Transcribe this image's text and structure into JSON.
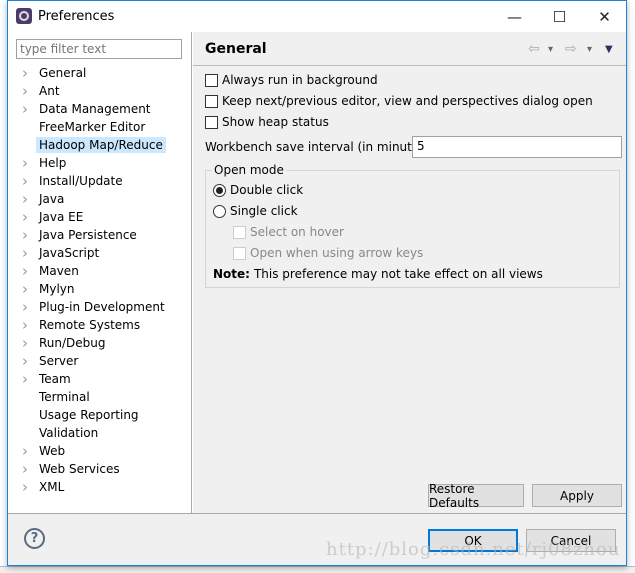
{
  "window": {
    "title": "Preferences",
    "minimize": "—",
    "maximize": "☐",
    "close": "✕"
  },
  "sidebar": {
    "filter_placeholder": "type filter text",
    "items": [
      {
        "label": "General",
        "expandable": true
      },
      {
        "label": "Ant",
        "expandable": true
      },
      {
        "label": "Data Management",
        "expandable": true
      },
      {
        "label": "FreeMarker Editor",
        "expandable": false
      },
      {
        "label": "Hadoop Map/Reduce",
        "expandable": false,
        "selected": true
      },
      {
        "label": "Help",
        "expandable": true
      },
      {
        "label": "Install/Update",
        "expandable": true
      },
      {
        "label": "Java",
        "expandable": true
      },
      {
        "label": "Java EE",
        "expandable": true
      },
      {
        "label": "Java Persistence",
        "expandable": true
      },
      {
        "label": "JavaScript",
        "expandable": true
      },
      {
        "label": "Maven",
        "expandable": true
      },
      {
        "label": "Mylyn",
        "expandable": true
      },
      {
        "label": "Plug-in Development",
        "expandable": true
      },
      {
        "label": "Remote Systems",
        "expandable": true
      },
      {
        "label": "Run/Debug",
        "expandable": true
      },
      {
        "label": "Server",
        "expandable": true
      },
      {
        "label": "Team",
        "expandable": true
      },
      {
        "label": "Terminal",
        "expandable": false
      },
      {
        "label": "Usage Reporting",
        "expandable": false
      },
      {
        "label": "Validation",
        "expandable": false
      },
      {
        "label": "Web",
        "expandable": true
      },
      {
        "label": "Web Services",
        "expandable": true
      },
      {
        "label": "XML",
        "expandable": true
      }
    ]
  },
  "main": {
    "title": "General",
    "back_icon": "⇦",
    "forward_icon": "⇨",
    "dropdown_icon": "▾",
    "menu_icon": "▼",
    "always_run_bg": {
      "label": "Always run in background",
      "checked": false
    },
    "keep_next_prev": {
      "label": "Keep next/previous editor, view and perspectives dialog open",
      "checked": false
    },
    "show_heap": {
      "label": "Show heap status",
      "checked": false
    },
    "save_interval_label": "Workbench save interval (in minutes):",
    "save_interval_value": "5",
    "open_mode": {
      "title": "Open mode",
      "double_click": "Double click",
      "single_click": "Single click",
      "selected": "Double click",
      "select_on_hover": "Select on hover",
      "open_arrow_keys": "Open when using arrow keys",
      "note_bold": "Note:",
      "note": "This preference may not take effect on all views"
    },
    "restore_defaults": "Restore Defaults",
    "apply": "Apply"
  },
  "footer": {
    "help_icon": "?",
    "ok": "OK",
    "cancel": "Cancel"
  },
  "watermark": "http://blog.csdn.net/rj08zhou"
}
